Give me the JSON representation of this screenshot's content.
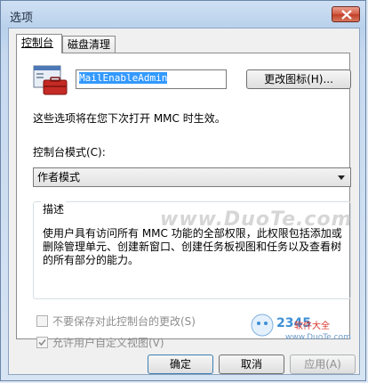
{
  "window": {
    "title": "选项"
  },
  "tabs": [
    {
      "label": "控制台"
    },
    {
      "label": "磁盘清理"
    }
  ],
  "console": {
    "name_value": "MailEnableAdmin",
    "change_icon_label": "更改图标(H)...",
    "info_text": "这些选项将在您下次打开 MMC 时生效。",
    "mode_label": "控制台模式(C):",
    "mode_selected": "作者模式",
    "description_legend": "描述",
    "description_text": "使用户具有访问所有 MMC 功能的全部权限，此权限包括添加或删除管理单元、创建新窗口、创建任务板视图和任务以及查看树的所有部分的能力。"
  },
  "checkboxes": {
    "do_not_save_label": "不要保存对此控制台的更改(S)",
    "do_not_save_checked": false,
    "allow_custom_view_label": "允许用户自定义视图(V)",
    "allow_custom_view_checked": true
  },
  "buttons": {
    "ok": "确定",
    "cancel": "取消",
    "apply": "应用(A)"
  },
  "watermark": {
    "text": "www.DuoTe.com"
  },
  "logo": {
    "number": "2345",
    "name": "软件大全",
    "url": "www.DuoTe.com"
  },
  "colors": {
    "selection": "#3399ff",
    "close_red": "#c0402a",
    "accent_blue": "#3c7fb1"
  }
}
